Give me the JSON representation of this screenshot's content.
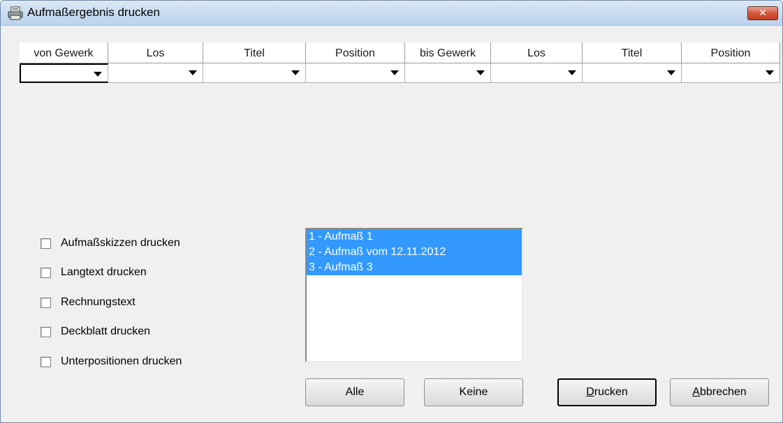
{
  "window": {
    "title": "Aufmaßergebnis drucken",
    "close_glyph": "✕"
  },
  "columns": [
    {
      "label": "von Gewerk"
    },
    {
      "label": "Los"
    },
    {
      "label": "Titel"
    },
    {
      "label": "Position"
    },
    {
      "label": "bis Gewerk"
    },
    {
      "label": "Los"
    },
    {
      "label": "Titel"
    },
    {
      "label": "Position"
    }
  ],
  "options": {
    "skizzen": "Aufmaßskizzen drucken",
    "langtext": "Langtext drucken",
    "rechnungstext": "Rechnungstext",
    "deckblatt": "Deckblatt drucken",
    "unterpositionen": "Unterpositionen drucken"
  },
  "aufmass_list": [
    "1 - Aufmaß 1",
    "2 - Aufmaß vom 12.11.2012",
    "3 - Aufmaß 3"
  ],
  "buttons": {
    "alle": "Alle",
    "keine": "Keine",
    "drucken_mnemonic": "D",
    "drucken_rest": "rucken",
    "abbrechen_mnemonic": "A",
    "abbrechen_rest": "bbrechen"
  },
  "colors": {
    "selection": "#3399ff",
    "titlebar": "#c9dcef",
    "close": "#c23a1f"
  }
}
